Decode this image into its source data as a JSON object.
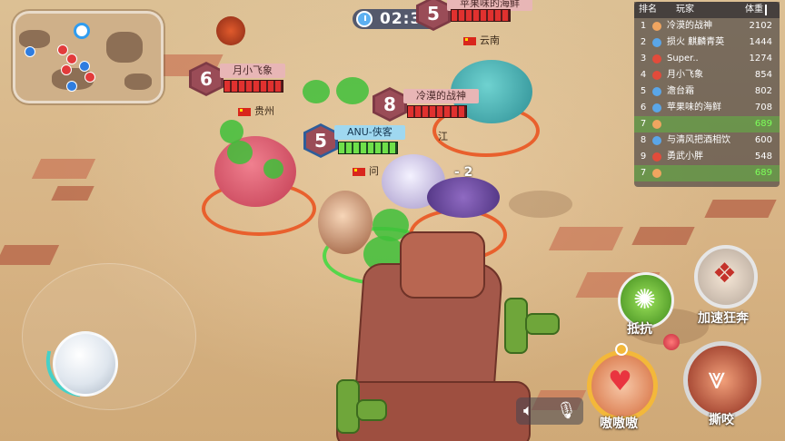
{
  "timer": "02:37",
  "players": [
    {
      "level": "6",
      "name": "月小飞象",
      "region": "贵州",
      "team": "red"
    },
    {
      "level": "8",
      "name": "冷漠的战神",
      "region": "",
      "team": "red"
    },
    {
      "level": "5",
      "name": "ANU-侠客",
      "region": "",
      "team": "blue"
    },
    {
      "level": "5",
      "name": "苹果味的海鲜",
      "region": "云南",
      "team": "red"
    }
  ],
  "partial_labels": {
    "region_fragment": "江",
    "name_fragment": "问",
    "damage_text": "- 2"
  },
  "leaderboard": {
    "header": {
      "rank": "排名",
      "player": "玩家",
      "weight": "体重"
    },
    "rows": [
      {
        "rank": "1",
        "icon": "crown-icon",
        "name": "冷漠的战神",
        "weight": "2102"
      },
      {
        "rank": "2",
        "icon": "blue-monster-icon",
        "name": "损火 麒麟青英",
        "weight": "1444"
      },
      {
        "rank": "3",
        "icon": "red-monster-icon",
        "name": "Super..",
        "weight": "1274"
      },
      {
        "rank": "4",
        "icon": "red-monster-icon",
        "name": "月小飞象",
        "weight": "854"
      },
      {
        "rank": "5",
        "icon": "blue-monster-icon",
        "name": "澹台霜",
        "weight": "802"
      },
      {
        "rank": "6",
        "icon": "blue-monster-icon",
        "name": "苹果味的海鲜",
        "weight": "708"
      },
      {
        "rank": "7",
        "icon": "fox-icon",
        "name": "",
        "weight": "689",
        "highlight": true
      },
      {
        "rank": "8",
        "icon": "blue-monster-icon",
        "name": "与清风把酒相饮",
        "weight": "600"
      },
      {
        "rank": "9",
        "icon": "red-monster-icon",
        "name": "勇武小胖",
        "weight": "548"
      },
      {
        "rank": "7",
        "icon": "fox-icon",
        "name": "",
        "weight": "689",
        "highlight": true
      }
    ]
  },
  "skills": {
    "resist": "抵抗",
    "sprint": "加速狂奔",
    "taunt": "嗷嗷嗷",
    "bite": "撕咬"
  },
  "colors": {
    "accent_red": "#e0312f",
    "accent_green": "#6fe04a",
    "ring_orange": "#e9602d"
  }
}
